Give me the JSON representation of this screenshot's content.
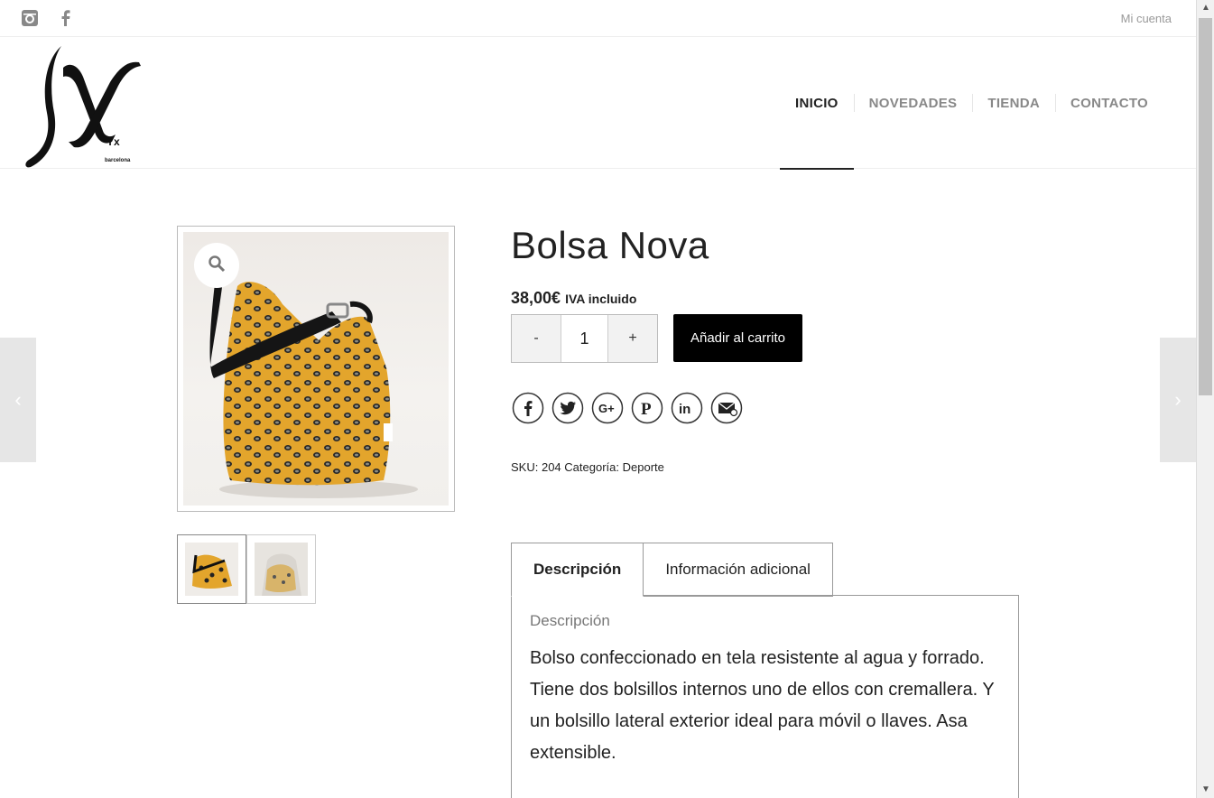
{
  "topbar": {
    "social": [
      {
        "icon": "instagram-icon"
      },
      {
        "icon": "facebook-icon"
      }
    ],
    "account_label": "Mi cuenta"
  },
  "header": {
    "logo_letters": "Yx",
    "logo_city": "barcelona",
    "nav": [
      {
        "label": "INICIO",
        "active": true
      },
      {
        "label": "NOVEDADES",
        "active": false
      },
      {
        "label": "TIENDA",
        "active": false
      },
      {
        "label": "CONTACTO",
        "active": false
      }
    ]
  },
  "product": {
    "title": "Bolsa Nova",
    "price": "38,00€",
    "price_note": "IVA incluido",
    "quantity": {
      "minus": "-",
      "value": "1",
      "plus": "+"
    },
    "add_to_cart": "Añadir al carrito",
    "share_icons": [
      "facebook-icon",
      "twitter-icon",
      "google-plus-icon",
      "pinterest-icon",
      "linkedin-icon",
      "email-icon"
    ],
    "meta": {
      "sku_label": "SKU:",
      "sku": "204",
      "category_label": "Categoría:",
      "category": "Deporte"
    }
  },
  "tabs": [
    {
      "label": "Descripción",
      "active": true
    },
    {
      "label": "Información adicional",
      "active": false
    }
  ],
  "description": {
    "heading": "Descripción",
    "text": "Bolso confeccionado en tela resistente al agua y forrado. Tiene dos bolsillos internos uno de ellos con cremallera. Y un bolsillo lateral exterior ideal para móvil o llaves. Asa extensible."
  },
  "colors": {
    "accent": "#000000",
    "bag_mustard": "#e3a52c",
    "nav_inactive": "#888888"
  }
}
